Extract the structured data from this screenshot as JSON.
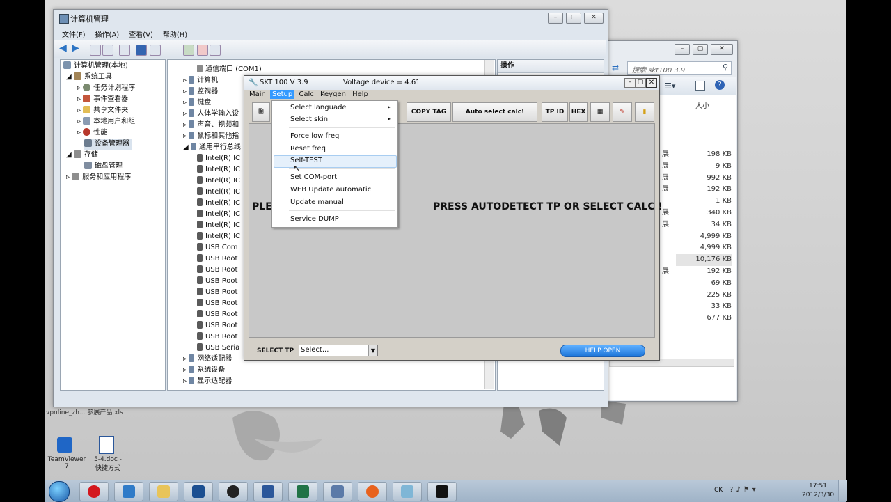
{
  "mmc": {
    "title": "计算机管理",
    "menu": [
      "文件(F)",
      "操作(A)",
      "查看(V)",
      "帮助(H)"
    ],
    "tree": {
      "root": "计算机管理(本地)",
      "system_tools": "系统工具",
      "task_scheduler": "任务计划程序",
      "event_viewer": "事件查看器",
      "shared_folders": "共享文件夹",
      "local_users": "本地用户和组",
      "performance": "性能",
      "device_manager": "设备管理器",
      "storage": "存储",
      "disk_mgmt": "磁盘管理",
      "services_apps": "服务和应用程序"
    },
    "devices": [
      "通信端口 (COM1)",
      "计算机",
      "监视器",
      "键盘",
      "人体学输入设",
      "声音、视频和",
      "鼠标和其他指",
      "通用串行总线",
      "Intel(R) IC",
      "Intel(R) IC",
      "Intel(R) IC",
      "Intel(R) IC",
      "Intel(R) IC",
      "Intel(R) IC",
      "Intel(R) IC",
      "Intel(R) IC",
      "USB Com",
      "USB Root",
      "USB Root",
      "USB Root",
      "USB Root",
      "USB Root",
      "USB Root",
      "USB Root",
      "USB Root",
      "USB Seria",
      "网络适配器",
      "系统设备",
      "显示适配器"
    ],
    "actions_header": "操作"
  },
  "explorer": {
    "search_placeholder": "搜索 skt100 3.9",
    "size_header": "大小",
    "sizes": [
      "198 KB",
      "9 KB",
      "992 KB",
      "192 KB",
      "1 KB",
      "340 KB",
      "34 KB",
      "4,999 KB",
      "4,999 KB",
      "10,176 KB",
      "192 KB",
      "69 KB",
      "225 KB",
      "33 KB",
      "677 KB"
    ],
    "type_fragment": "展"
  },
  "skt": {
    "title": "SKT 100  V 3.9",
    "voltage": "Voltage device = 4.61",
    "menu": [
      "Main",
      "Setup",
      "Calc",
      "Keygen",
      "Help"
    ],
    "buttons": {
      "copy_tag": "COPY TAG",
      "auto_select": "Auto select calc!",
      "tp_id": "TP ID",
      "hex": "HEX"
    },
    "message_left": "PLE",
    "message_right": "PRESS AUTODETECT TP OR SELECT CALC !",
    "select_tp_label": "SELECT TP",
    "select_tp_value": "Select...",
    "help_button": "HELP OPEN",
    "setup_menu": [
      "Select languade",
      "Select skin",
      "Force low freq",
      "Reset freq",
      "Self-TEST",
      "Set COM-port",
      "WEB Update automatic",
      "Update manual",
      "Service DUMP"
    ]
  },
  "desktop": {
    "file_label": "vpnline_zh...   参展产品.xls",
    "icon1": "TeamViewer 7",
    "icon2": "5-4.doc - 快捷方式"
  },
  "tray": {
    "lang": "CK",
    "time": "17:51",
    "date": "2012/3/30"
  }
}
